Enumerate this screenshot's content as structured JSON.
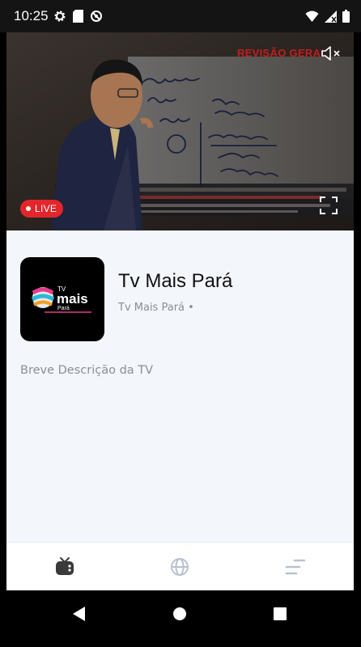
{
  "status_bar": {
    "time": "10:25",
    "left_icons": [
      "settings-icon",
      "sd-card-icon",
      "blocked-icon"
    ],
    "right_icons": [
      "wifi-icon",
      "signal-icon",
      "battery-icon"
    ]
  },
  "video": {
    "caption": "REVISÃO GERAL",
    "live_label": "LIVE",
    "muted": true
  },
  "channel": {
    "logo_text": {
      "line1": "TV",
      "line2": "mais",
      "line3": "Pará"
    },
    "name": "Tv Mais Pará",
    "subtitle": "Tv Mais Pará •",
    "description": "Breve Descrição da TV"
  },
  "bottom_nav": {
    "tabs": [
      {
        "icon": "tv-icon",
        "active": true
      },
      {
        "icon": "globe-icon",
        "active": false
      },
      {
        "icon": "menu-lines-icon",
        "active": false
      }
    ]
  },
  "android_nav": [
    "back-icon",
    "home-icon",
    "recents-icon"
  ],
  "colors": {
    "live_red": "#e3262c",
    "caption_red": "#c51d1d",
    "panel_bg": "#f3f6fa",
    "inactive_icon": "#b7c3cf",
    "active_icon": "#3a3a3a"
  }
}
